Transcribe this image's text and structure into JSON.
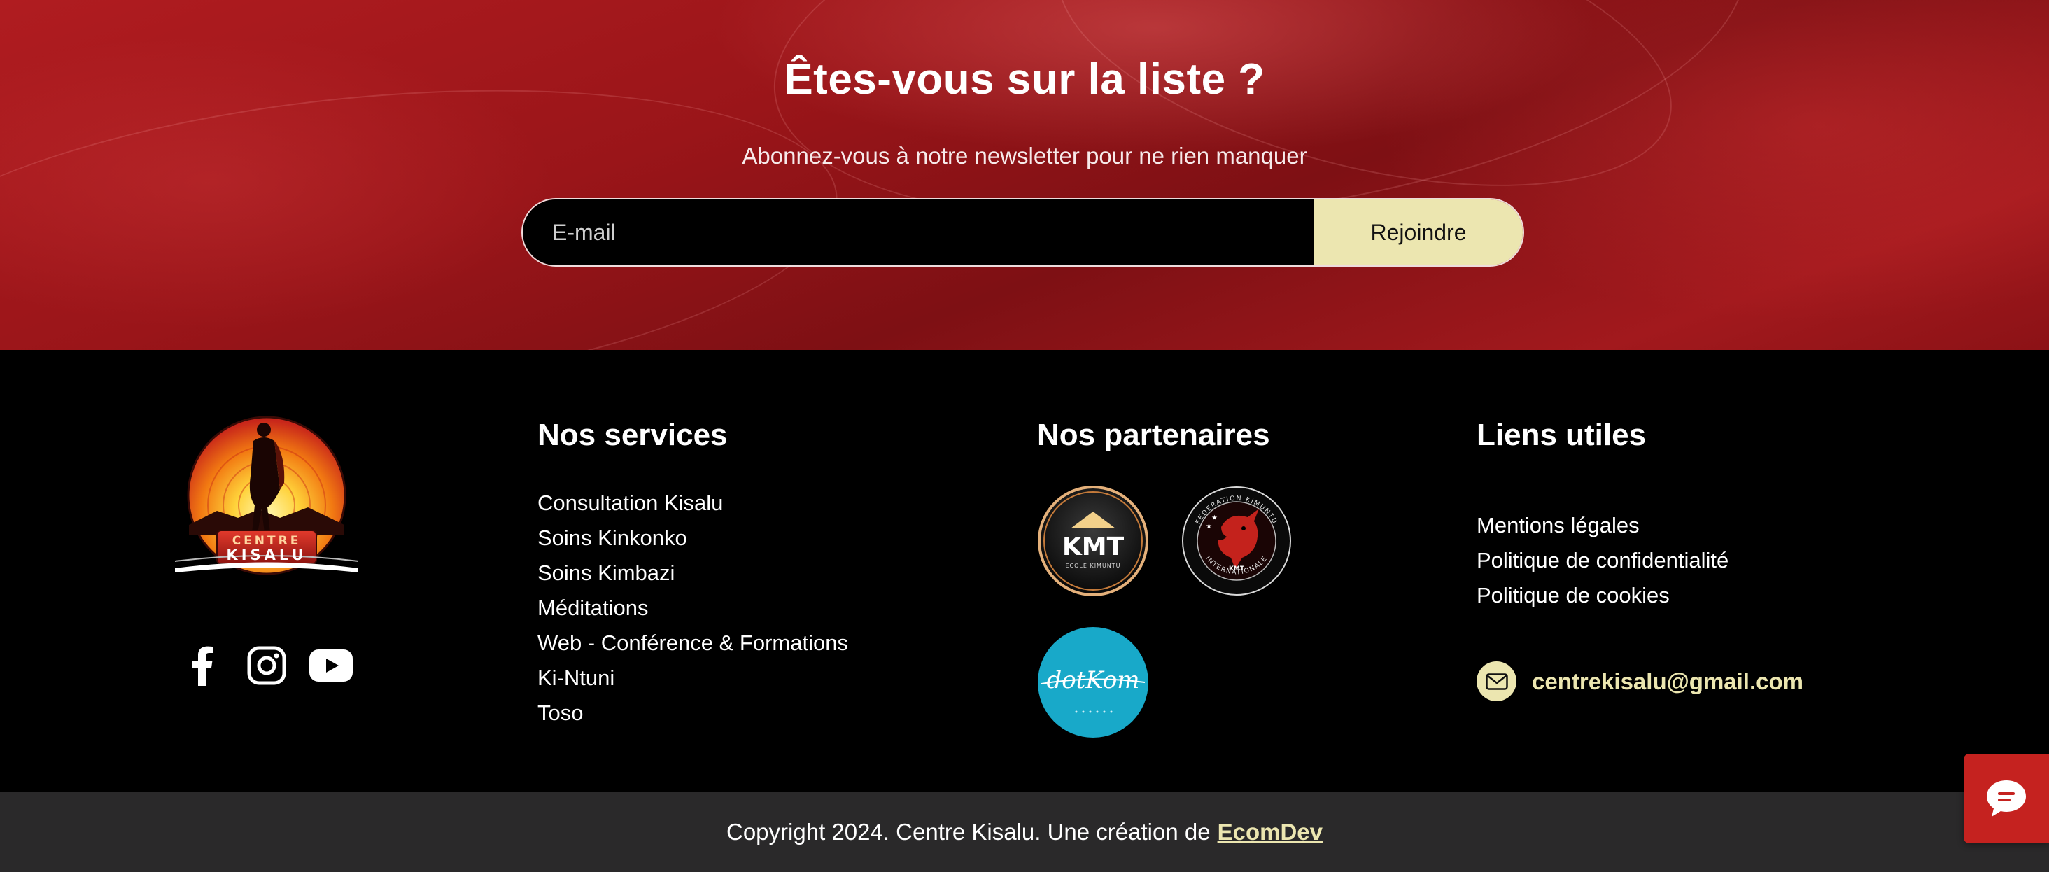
{
  "newsletter": {
    "title": "Êtes-vous sur la liste ?",
    "subtitle": "Abonnez-vous à notre newsletter pour ne rien manquer",
    "email_placeholder": "E-mail",
    "email_value": "",
    "button_label": "Rejoindre"
  },
  "logo": {
    "line1": "CENTRE",
    "line2": "KISALU"
  },
  "social": [
    {
      "icon": "facebook-icon"
    },
    {
      "icon": "instagram-icon"
    },
    {
      "icon": "youtube-icon"
    }
  ],
  "services": {
    "title": "Nos services",
    "items": [
      "Consultation Kisalu",
      "Soins Kinkonko",
      "Soins Kimbazi",
      "Méditations",
      "Web - Conférence & Formations",
      "Ki-Ntuni",
      "Toso"
    ]
  },
  "partners": {
    "title": "Nos partenaires",
    "kmt": {
      "main": "KMT",
      "sub": "ECOLE KIMUNTU"
    },
    "federation": {
      "top": "FEDERATION KIMUNTU",
      "bottom": "INTERNATIONALE",
      "badge": "KMT"
    },
    "dotkom": {
      "text": "dotKom"
    }
  },
  "links": {
    "title": "Liens utiles",
    "items": [
      "Mentions légales",
      "Politique de confidentialité",
      "Politique de cookies"
    ],
    "email": "centrekisalu@gmail.com"
  },
  "copyright": {
    "text": "Copyright 2024. Centre Kisalu. Une création de",
    "link": "EcomDev"
  },
  "colors": {
    "accent": "#ece6b0",
    "brand_red": "#c5221f",
    "bottom_bar": "#2a292a"
  }
}
